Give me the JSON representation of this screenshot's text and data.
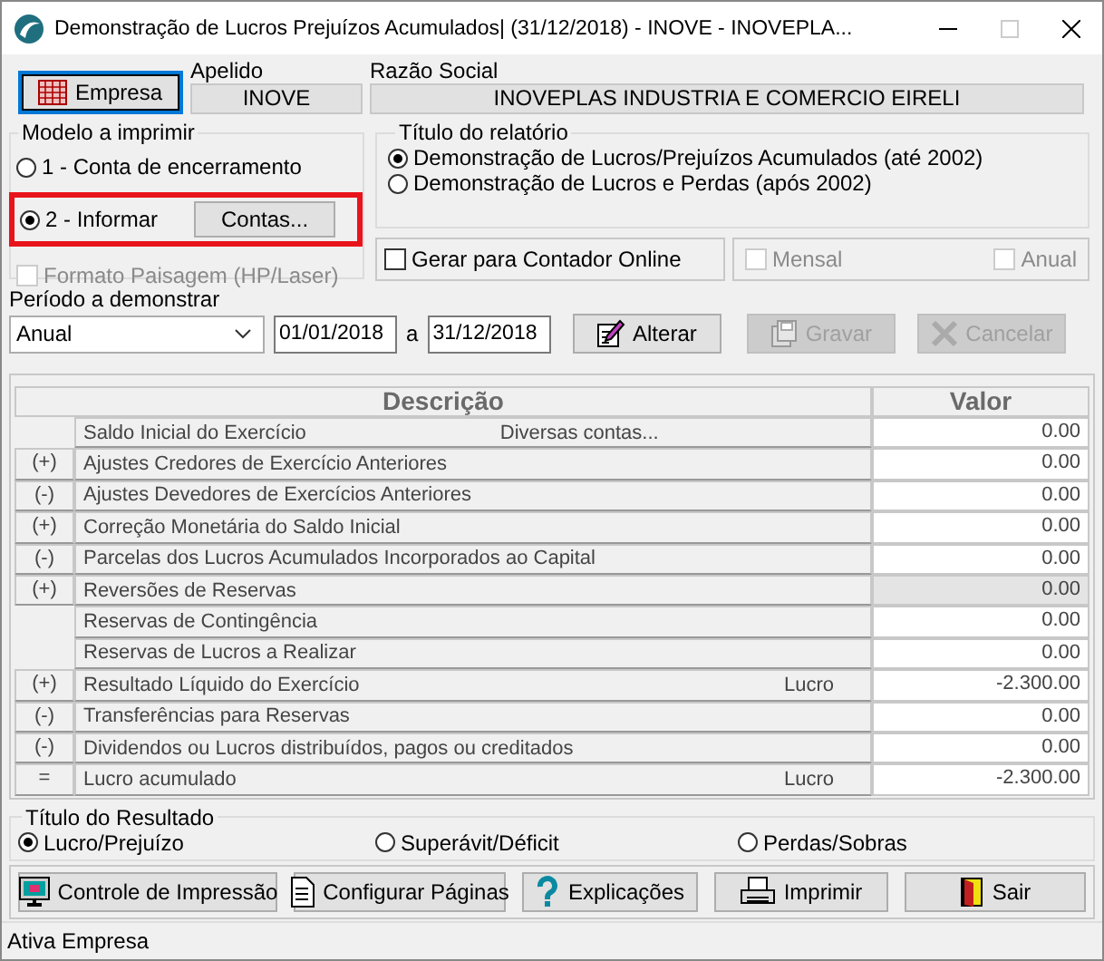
{
  "window": {
    "title": "Demonstração de Lucros Prejuízos Acumulados| (31/12/2018) - INOVE - INOVEPLA..."
  },
  "company": {
    "button": "Empresa",
    "apelido_label": "Apelido",
    "apelido": "INOVE",
    "razao_label": "Razão Social",
    "razao": "INOVEPLAS INDUSTRIA E COMERCIO EIRELI"
  },
  "modelo": {
    "title": "Modelo a imprimir",
    "options": [
      {
        "label": "1 - Conta de encerramento",
        "selected": false,
        "highlighted": false
      },
      {
        "label": "2 - Informar",
        "selected": true,
        "highlighted": true
      }
    ],
    "contas_button": "Contas...",
    "landscape": {
      "label": "Formato Paisagem (HP/Laser)",
      "checked": false,
      "disabled": true
    }
  },
  "titulo_relatorio": {
    "title": "Título do relatório",
    "options": [
      {
        "label": "Demonstração de Lucros/Prejuízos Acumulados (até 2002)",
        "selected": true
      },
      {
        "label": "Demonstração de Lucros e Perdas (após 2002)",
        "selected": false
      }
    ]
  },
  "options": [
    {
      "label": "Gerar para Contador Online",
      "checked": false,
      "disabled": false
    },
    {
      "label": "Mensal",
      "checked": false,
      "disabled": true
    },
    {
      "label": "Anual",
      "checked": false,
      "disabled": true
    }
  ],
  "periodo": {
    "label": "Período a demonstrar",
    "select": "Anual",
    "from": "01/01/2018",
    "separator": "a",
    "to": "31/12/2018"
  },
  "actions": [
    {
      "label": "Alterar",
      "disabled": false
    },
    {
      "label": "Gravar",
      "disabled": true
    },
    {
      "label": "Cancelar",
      "disabled": true
    }
  ],
  "table": {
    "columns": [
      "Descrição",
      "Valor"
    ],
    "rows": [
      {
        "label": "Saldo Inicial do Exercício",
        "link": "Diversas contas...",
        "value": "0.00",
        "readonly": false
      },
      {
        "sign": "(+)",
        "label": "Ajustes Credores de Exercício Anteriores",
        "value": "0.00",
        "readonly": false
      },
      {
        "sign": "(-)",
        "label": "Ajustes Devedores de Exercícios Anteriores",
        "value": "0.00",
        "readonly": false
      },
      {
        "sign": "(+)",
        "label": "Correção Monetária do Saldo Inicial",
        "value": "0.00",
        "readonly": false
      },
      {
        "sign": "(-)",
        "label": "Parcelas dos Lucros Acumulados Incorporados ao Capital",
        "value": "0.00",
        "readonly": false
      },
      {
        "sign": "(+)",
        "label": "Reversões de Reservas",
        "value": "0.00",
        "readonly": true
      },
      {
        "label": "Reservas de Contingência",
        "value": "0.00",
        "readonly": false
      },
      {
        "label": "Reservas de Lucros a Realizar",
        "value": "0.00",
        "readonly": false
      },
      {
        "sign": "(+)",
        "label": "Resultado Líquido do Exercício",
        "note": "Lucro",
        "value": "-2.300.00",
        "readonly": false
      },
      {
        "sign": "(-)",
        "label": "Transferências para Reservas",
        "value": "0.00",
        "readonly": false
      },
      {
        "sign": "(-)",
        "label": "Dividendos ou Lucros distribuídos, pagos ou creditados",
        "value": "0.00",
        "readonly": false
      },
      {
        "sign": "=",
        "label": "Lucro acumulado",
        "note": "Lucro",
        "value": "-2.300.00",
        "readonly": false
      }
    ]
  },
  "resultado": {
    "title": "Título do Resultado",
    "options": [
      {
        "label": "Lucro/Prejuízo",
        "selected": true
      },
      {
        "label": "Superávit/Déficit",
        "selected": false
      },
      {
        "label": "Perdas/Sobras",
        "selected": false
      }
    ]
  },
  "buttons": [
    {
      "label": "Controle de Impressão"
    },
    {
      "label": "Configurar Páginas"
    },
    {
      "label": "Explicações"
    },
    {
      "label": "Imprimir"
    },
    {
      "label": "Sair"
    }
  ],
  "status_bar": "Ativa Empresa"
}
